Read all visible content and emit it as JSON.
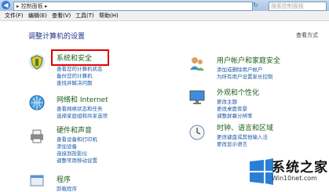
{
  "address_bar": {
    "path": "▸ 控制面板 ▸"
  },
  "search": {
    "placeholder": "搜索控制面板"
  },
  "menu": [
    "文件(F)",
    "编辑(E)",
    "查看(V)",
    "工具(T)",
    "帮助(H)"
  ],
  "heading": "调整计算机的设置",
  "view_by": "查看方式",
  "categories_left": [
    {
      "title": "系统和安全",
      "links": [
        "查看您的计算机状态",
        "备份您的计算机",
        "查找并解决问题"
      ]
    },
    {
      "title": "网络和 Internet",
      "links": [
        "查看网络状态和任务",
        "选择家庭组和共享选项"
      ]
    },
    {
      "title": "硬件和声音",
      "links": [
        "查看设备和打印机",
        "添加设备",
        "连接到投影仪",
        "调整常用移动设置"
      ]
    },
    {
      "title": "程序",
      "links": [
        "卸载程序"
      ]
    }
  ],
  "categories_right": [
    {
      "title": "用户帐户和家庭安全",
      "links": [
        "添加或删除用户帐户",
        "为所有用户设置家长控制"
      ]
    },
    {
      "title": "外观和个性化",
      "links": [
        "更改主题",
        "更改桌面背景",
        "调整屏幕分辨率"
      ]
    },
    {
      "title": "时钟、语言和区域",
      "links": [
        "更改键盘或其他输入法",
        "更改显示语言"
      ]
    }
  ],
  "watermark": {
    "title": "系统之家",
    "url": "Win10net.com"
  },
  "colors": {
    "highlight": "#e00000",
    "link": "#1e5aa8",
    "category_title": "#1a5e1a"
  }
}
